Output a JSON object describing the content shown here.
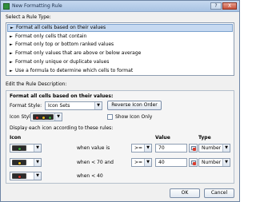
{
  "window": {
    "title": "New Formatting Rule",
    "help_label": "?",
    "close_label": "X"
  },
  "select_rule_type": {
    "label": "Select a Rule Type:",
    "items": [
      {
        "label": "Format all cells based on their values",
        "selected": true
      },
      {
        "label": "Format only cells that contain",
        "selected": false
      },
      {
        "label": "Format only top or bottom ranked values",
        "selected": false
      },
      {
        "label": "Format only values that are above or below average",
        "selected": false
      },
      {
        "label": "Format only unique or duplicate values",
        "selected": false
      },
      {
        "label": "Use a formula to determine which cells to format",
        "selected": false
      }
    ],
    "arrow_glyph": "►"
  },
  "edit_description": {
    "label": "Edit the Rule Description:",
    "heading": "Format all cells based on their values:",
    "format_style_label": "Format Style:",
    "format_style_value": "Icon Sets",
    "reverse_button": "Reverse Icon Order",
    "icon_style_label": "Icon Style:",
    "show_icon_only_label": "Show Icon Only",
    "show_icon_only_checked": false,
    "rules_label": "Display each icon according to these rules:",
    "columns": {
      "icon": "Icon",
      "value": "Value",
      "type": "Type"
    },
    "rules": [
      {
        "icon": "green-light-icon",
        "condition": "when value is",
        "operator": ">=",
        "value": "70",
        "type": "Number"
      },
      {
        "icon": "yellow-light-icon",
        "condition": "when < 70 and",
        "operator": ">=",
        "value": "40",
        "type": "Number"
      },
      {
        "icon": "red-light-icon",
        "condition": "when < 40"
      }
    ],
    "icon_style_lights": [
      "#d9342b",
      "#f2c21b",
      "#3aa43a"
    ],
    "light_colors": {
      "green": "#3aa43a",
      "yellow": "#f2c21b",
      "red": "#d9342b"
    },
    "dropdown_caret": "▼"
  },
  "footer": {
    "ok_label": "OK",
    "cancel_label": "Cancel"
  }
}
